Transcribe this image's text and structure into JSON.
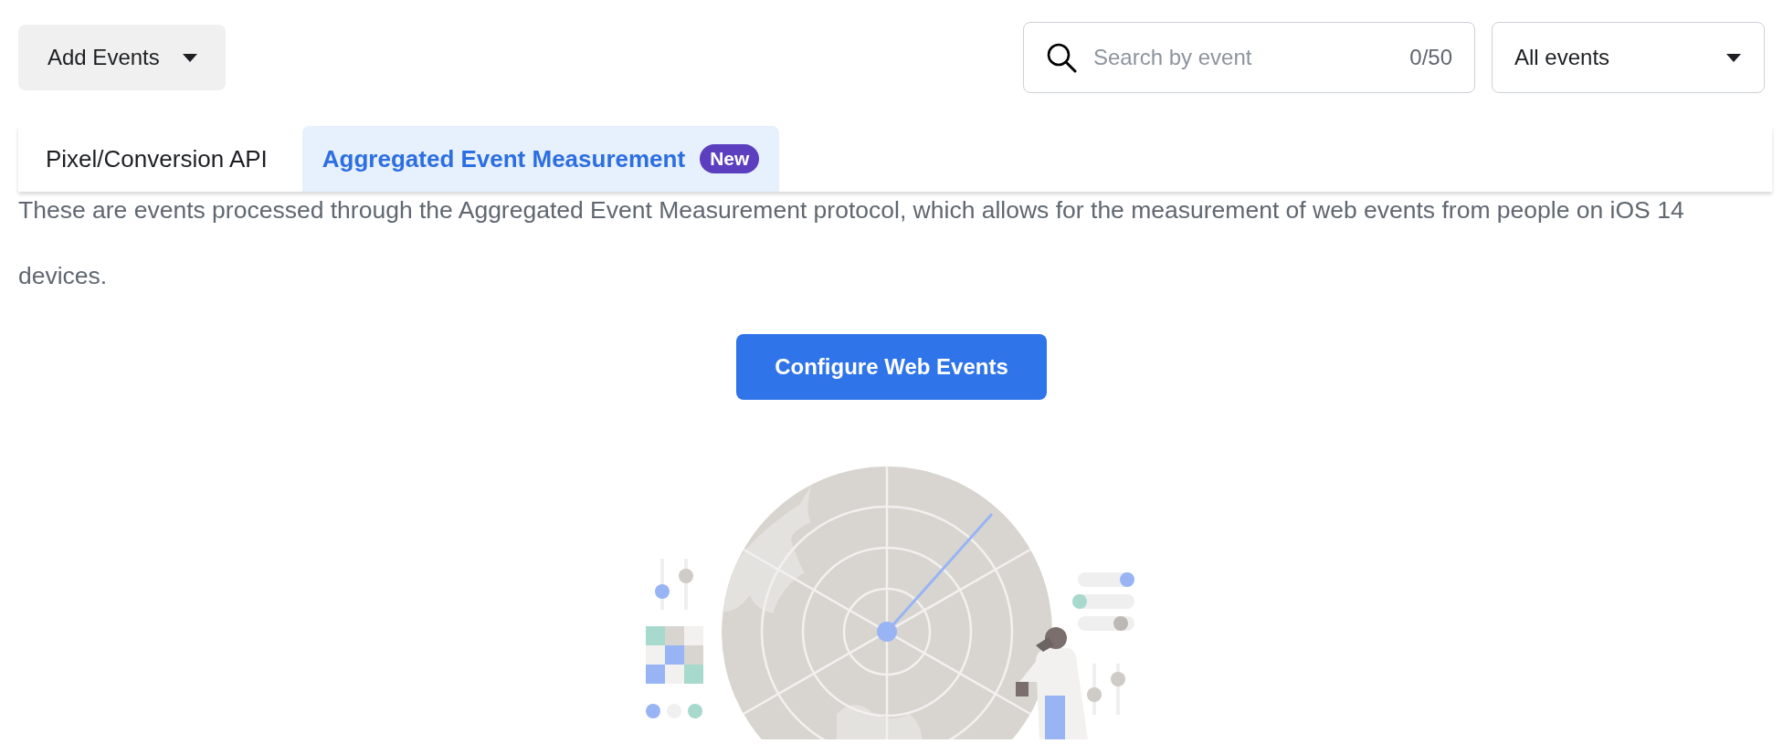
{
  "add_button": {
    "label": "Add Events"
  },
  "search": {
    "placeholder": "Search by event",
    "counter": "0/50"
  },
  "filter": {
    "value": "All events"
  },
  "tabs": [
    {
      "label": "Pixel/Conversion API",
      "selected": false
    },
    {
      "label": "Aggregated Event Measurement",
      "selected": true,
      "badge": "New"
    }
  ],
  "description": "These are events processed through the Aggregated Event Measurement protocol, which allows for the measurement of web events from people on iOS 14 devices.",
  "primary_button": {
    "label": "Configure Web Events"
  }
}
